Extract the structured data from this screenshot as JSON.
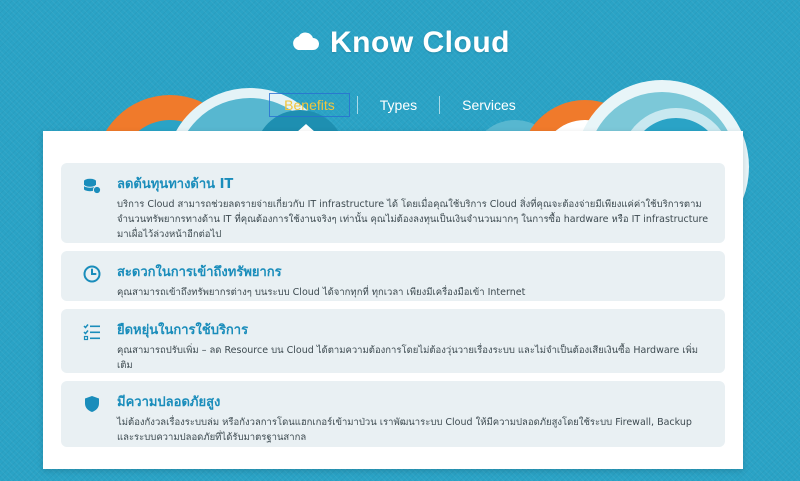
{
  "header": {
    "title": "Know Cloud"
  },
  "nav": {
    "tabs": [
      {
        "label": "Benefits",
        "active": true
      },
      {
        "label": "Types",
        "active": false
      },
      {
        "label": "Services",
        "active": false
      }
    ]
  },
  "cards": [
    {
      "icon": "database-coins-icon",
      "title": "ลดต้นทุนทางด้าน IT",
      "text": "บริการ Cloud สามารถช่วยลดรายจ่ายเกี่ยวกับ IT infrastructure ได้ โดยเมื่อคุณใช้บริการ Cloud สิ่งที่คุณจะต้องจ่ายมีเพียงแค่ค่าใช้บริการตามจำนวนทรัพยากรทางด้าน IT ที่คุณต้องการใช้งานจริงๆ เท่านั้น คุณไม่ต้องลงทุนเป็นเงินจำนวนมากๆ ในการซื้อ hardware หรือ IT infrastructure มาเผื่อไว้ล่วงหน้าอีกต่อไป"
    },
    {
      "icon": "clock-icon",
      "title": "สะดวกในการเข้าถึงทรัพยากร",
      "text": "คุณสามารถเข้าถึงทรัพยากรต่างๆ บนระบบ Cloud ได้จากทุกที่ ทุกเวลา เพียงมีเครื่องมือเข้า Internet"
    },
    {
      "icon": "checklist-icon",
      "title": "ยืดหยุ่นในการใช้บริการ",
      "text": "คุณสามารถปรับเพิ่ม – ลด Resource บน Cloud ได้ตามความต้องการโดยไม่ต้องวุ่นวายเรื่องระบบ และไม่จำเป็นต้องเสียเงินซื้อ Hardware เพิ่มเติม"
    },
    {
      "icon": "shield-icon",
      "title": "มีความปลอดภัยสูง",
      "text": "ไม่ต้องกังวลเรื่องระบบล่ม หรือกังวลการโดนแฮกเกอร์เข้ามาป่วน เราพัฒนาระบบ Cloud ให้มีความปลอดภัยสูงโดยใช้ระบบ Firewall, Backup และระบบความปลอดภัยที่ได้รับมาตรฐานสากล"
    }
  ],
  "colors": {
    "background": "#2aa3c6",
    "accent_orange": "#f07a2b",
    "active_tab": "#f2c53d",
    "card_title": "#1a8dbb",
    "card_bg": "#e9f0f3"
  }
}
